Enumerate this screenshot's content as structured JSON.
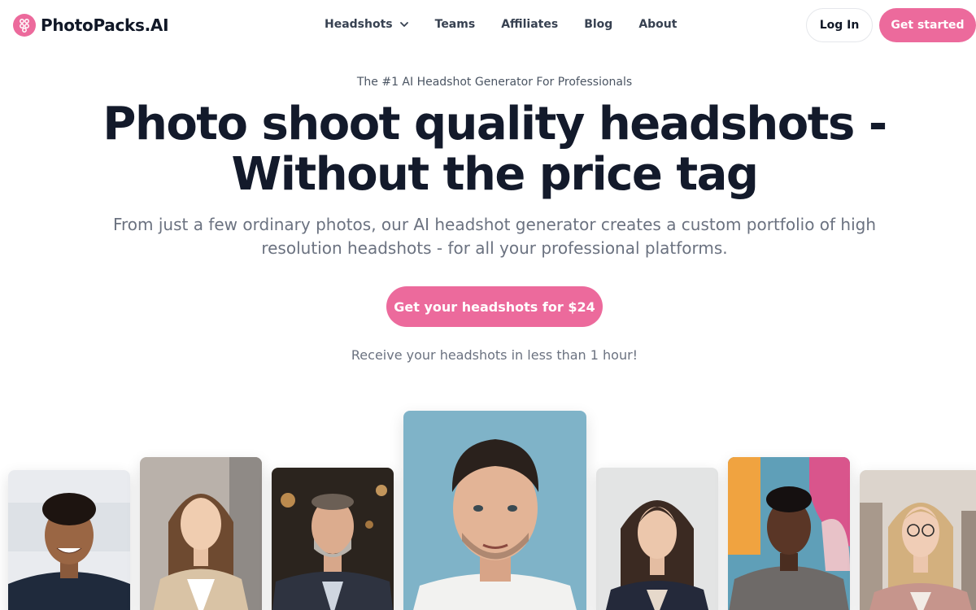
{
  "header": {
    "brand": "PhotoPacks.AI",
    "nav": [
      {
        "label": "Headshots",
        "has_dropdown": true
      },
      {
        "label": "Teams"
      },
      {
        "label": "Affiliates"
      },
      {
        "label": "Blog"
      },
      {
        "label": "About"
      }
    ],
    "login_label": "Log In",
    "get_started_label": "Get started"
  },
  "hero": {
    "tagline": "The #1 AI Headshot Generator For Professionals",
    "headline_line1": "Photo shoot quality headshots -",
    "headline_line2": "Without the price tag",
    "subtitle_line1": "From just a few ordinary photos, our AI headshot generator creates a custom portfolio of high",
    "subtitle_line2": "resolution headshots - for all your professional platforms.",
    "cta_label": "Get your headshots for $24",
    "note": "Receive your headshots in less than 1 hour!"
  },
  "colors": {
    "accent": "#ec6a9c",
    "heading": "#131a2b",
    "muted": "#6b7280"
  }
}
